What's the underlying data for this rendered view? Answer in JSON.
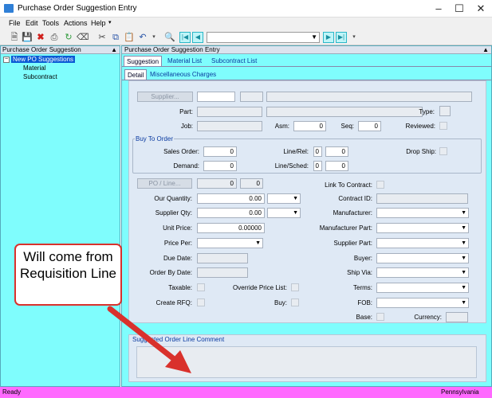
{
  "window": {
    "title": "Purchase Order Suggestion Entry"
  },
  "menu": [
    "File",
    "Edit",
    "Tools",
    "Actions",
    "Help"
  ],
  "tree": {
    "panel_title": "Purchase Order Suggestion",
    "root": "New PO Suggestions",
    "children": [
      "Material",
      "Subcontract"
    ]
  },
  "main": {
    "panel_title": "Purchase Order Suggestion Entry",
    "tabs": [
      "Suggestion",
      "Material List",
      "Subcontract List"
    ],
    "subtabs": [
      "Detail",
      "Miscellaneous Charges"
    ]
  },
  "form": {
    "supplier_btn": "Supplier...",
    "part_lbl": "Part:",
    "type_lbl": "Type:",
    "job_lbl": "Job:",
    "asm_lbl": "Asm:",
    "asm_val": "0",
    "seq_lbl": "Seq:",
    "seq_val": "0",
    "reviewed_lbl": "Reviewed:",
    "buy_to_order": "Buy To Order",
    "sales_order_lbl": "Sales Order:",
    "sales_order_val": "0",
    "line_rel_lbl": "Line/Rel:",
    "line_val": "0",
    "rel_val": "0",
    "drop_ship_lbl": "Drop Ship:",
    "demand_lbl": "Demand:",
    "demand_val": "0",
    "line_sched_lbl": "Line/Sched:",
    "line2_val": "0",
    "sched_val": "0",
    "po_line_btn": "PO / Line...",
    "po_val": "0",
    "po_line_val": "0",
    "link_contract_lbl": "Link To Contract:",
    "our_qty_lbl": "Our Quantity:",
    "our_qty_val": "0.00",
    "contract_id_lbl": "Contract ID:",
    "supplier_qty_lbl": "Supplier Qty:",
    "supplier_qty_val": "0.00",
    "manufacturer_lbl": "Manufacturer:",
    "unit_price_lbl": "Unit Price:",
    "unit_price_val": "0.00000",
    "manufacturer_part_lbl": "Manufacturer Part:",
    "price_per_lbl": "Price Per:",
    "supplier_part_lbl": "Supplier Part:",
    "due_date_lbl": "Due Date:",
    "buyer_lbl": "Buyer:",
    "order_by_lbl": "Order By Date:",
    "ship_via_lbl": "Ship Via:",
    "taxable_lbl": "Taxable:",
    "override_lbl": "Override Price List:",
    "terms_lbl": "Terms:",
    "create_rfq_lbl": "Create RFQ:",
    "buy_lbl": "Buy:",
    "fob_lbl": "FOB:",
    "base_lbl": "Base:",
    "currency_lbl": "Currency:",
    "comment_lbl": "Suggested Order Line Comment"
  },
  "status": {
    "left": "Ready",
    "right": "Pennsylvania"
  },
  "annotation": {
    "text": "Will come from Requisition Line",
    "color": "#d9312c"
  },
  "colors": {
    "panel_bg": "#7ffdfd",
    "status_bg": "#ff69ff",
    "selection": "#0a5ad4"
  }
}
